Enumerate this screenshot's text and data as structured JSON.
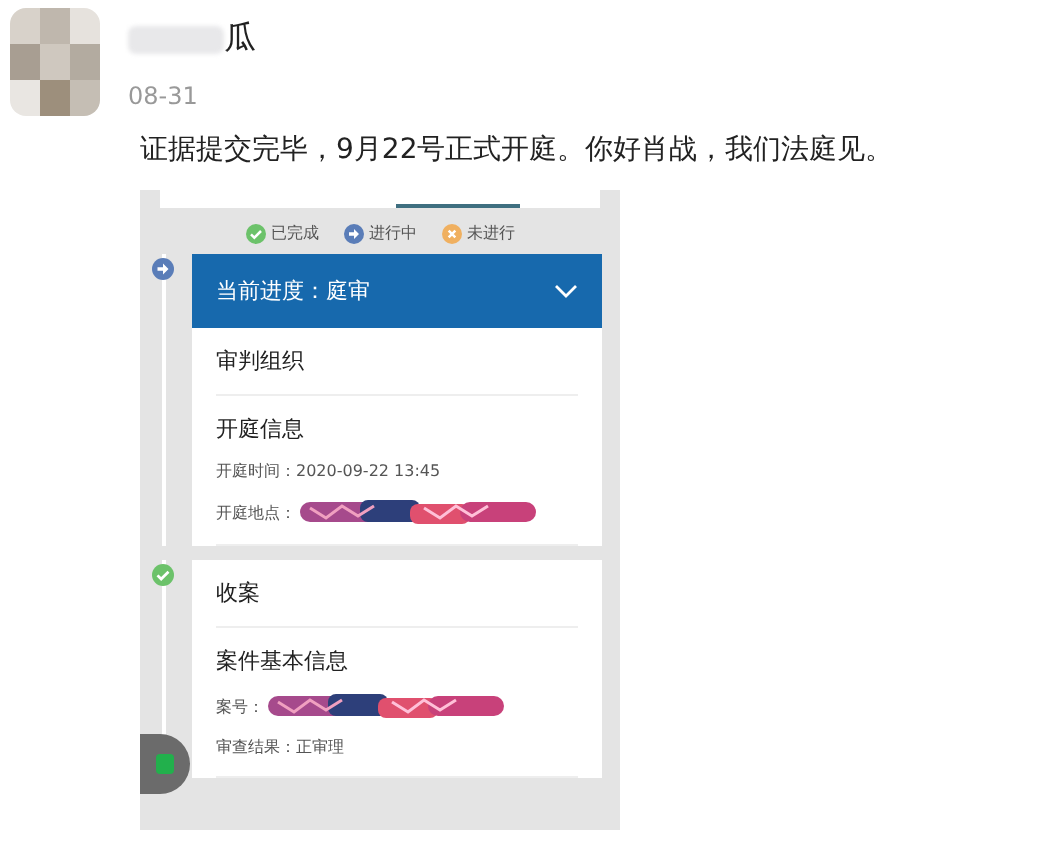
{
  "post": {
    "author_name": "瓜",
    "date": "08-31",
    "text": "证据提交完毕，9月22号正式开庭。你好肖战，我们法庭见。"
  },
  "embedded_screenshot": {
    "legend": [
      {
        "label": "已完成",
        "kind": "done"
      },
      {
        "label": "进行中",
        "kind": "ongoing"
      },
      {
        "label": "未进行",
        "kind": "pending"
      }
    ],
    "stages": [
      {
        "kind": "current",
        "title": "当前进度：庭审",
        "expanded": true,
        "sections": [
          {
            "heading": "审判组织"
          },
          {
            "heading": "开庭信息",
            "fields": [
              {
                "label": "开庭时间：",
                "value": "2020-09-22 13:45"
              },
              {
                "label": "开庭地点：",
                "redacted": true
              }
            ]
          }
        ]
      },
      {
        "kind": "done",
        "title": "收案",
        "sections": [
          {
            "heading": "案件基本信息",
            "fields": [
              {
                "label": "案号：",
                "redacted": true
              },
              {
                "label": "审查结果：",
                "value": "正审理"
              }
            ]
          }
        ]
      }
    ]
  }
}
